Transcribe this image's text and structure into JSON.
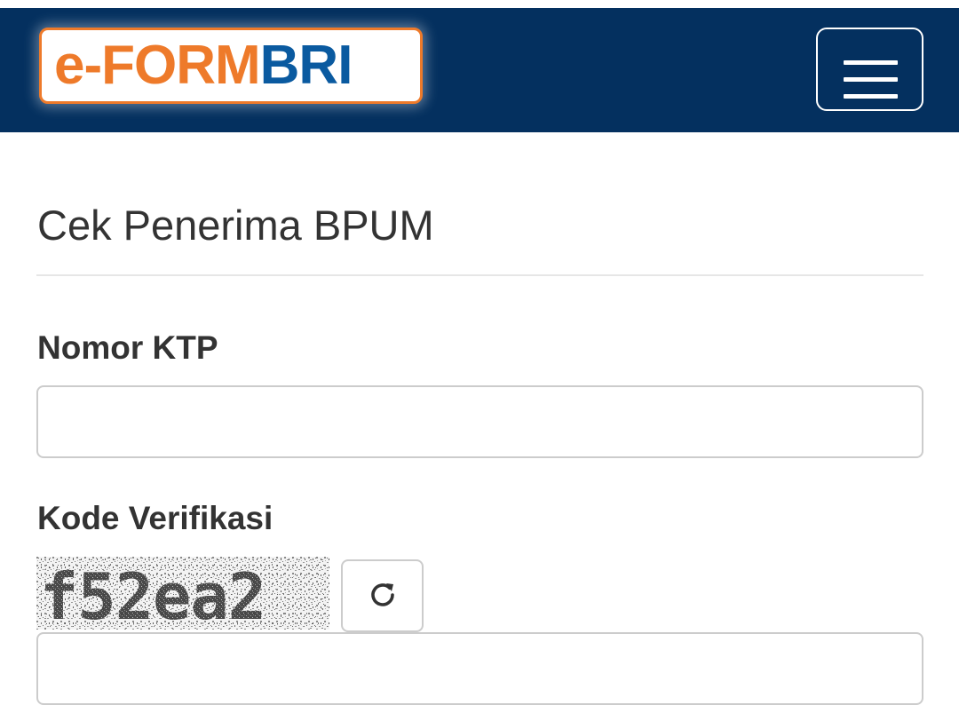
{
  "header": {
    "logo": {
      "part1": "e-FORM",
      "part2": "BRI",
      "colors": {
        "orange": "#ee7a2a",
        "blue": "#0a5aa0"
      }
    },
    "menu_icon": "hamburger-icon",
    "background": "#04305f"
  },
  "main": {
    "title": "Cek Penerima BPUM",
    "ktp": {
      "label": "Nomor KTP",
      "value": "",
      "placeholder": ""
    },
    "verification": {
      "label": "Kode Verifikasi",
      "captcha_text": "f52ea2",
      "refresh_icon": "refresh-icon",
      "value": "",
      "placeholder": ""
    }
  }
}
